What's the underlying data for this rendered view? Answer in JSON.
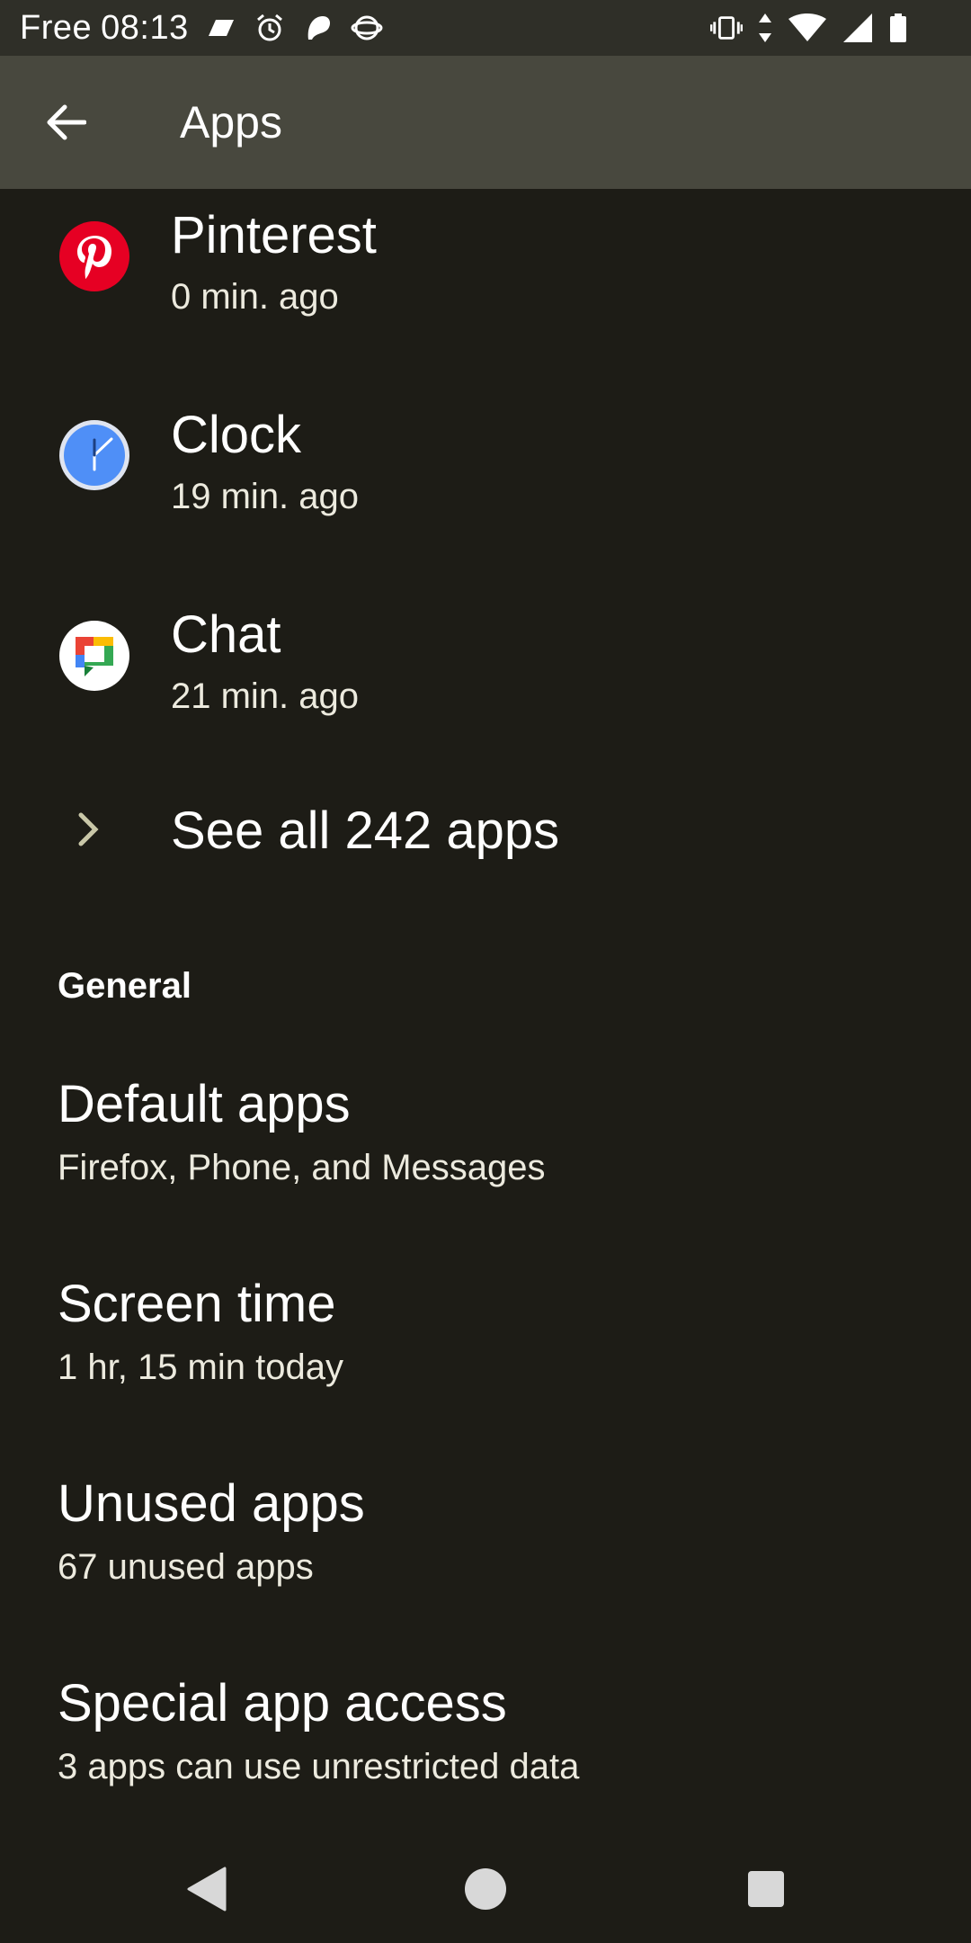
{
  "status_bar": {
    "carrier": "Free",
    "time": "08:13",
    "left_icons": [
      "data-saver-icon",
      "alarm-icon",
      "paw-app-icon",
      "vpn-globe-icon"
    ],
    "right_icons": [
      "vibrate-icon",
      "data-arrows-icon",
      "wifi-icon",
      "signal-icon",
      "battery-icon"
    ]
  },
  "app_bar": {
    "title": "Apps",
    "back_icon": "arrow-back-icon"
  },
  "recent_apps": [
    {
      "name": "Pinterest",
      "time": "0 min. ago",
      "icon": "pinterest-icon",
      "color": "#e60023"
    },
    {
      "name": "Clock",
      "time": "19 min. ago",
      "icon": "clock-icon",
      "color": "#4f8ff7"
    },
    {
      "name": "Chat",
      "time": "21 min. ago",
      "icon": "chat-icon",
      "color": "#ffffff"
    }
  ],
  "see_all": {
    "label": "See all 242 apps",
    "icon": "chevron-right-icon"
  },
  "general": {
    "header": "General",
    "items": [
      {
        "title": "Default apps",
        "subtitle": "Firefox, Phone, and Messages"
      },
      {
        "title": "Screen time",
        "subtitle": "1 hr, 15 min today"
      },
      {
        "title": "Unused apps",
        "subtitle": "67 unused apps"
      },
      {
        "title": "Special app access",
        "subtitle": "3 apps can use unrestricted data"
      }
    ]
  },
  "nav_bar": {
    "icons": [
      "nav-back-icon",
      "nav-home-icon",
      "nav-recents-icon"
    ]
  },
  "colors": {
    "background": "#1d1c16",
    "app_bar": "#48483e",
    "status_bar": "#2f2f28",
    "accent_chevron": "#c9c7a8"
  }
}
